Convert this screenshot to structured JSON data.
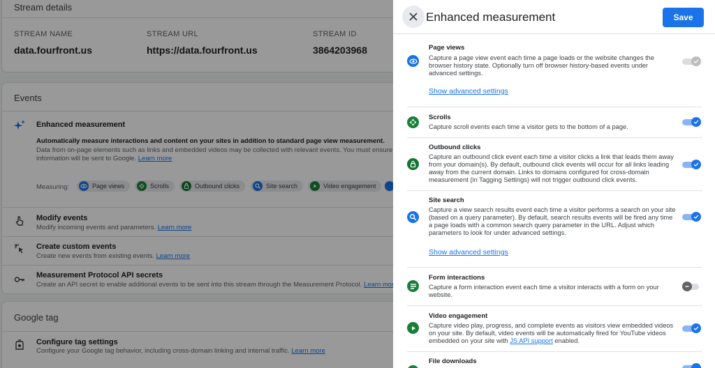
{
  "stream_details": {
    "title": "Stream details",
    "name_label": "STREAM NAME",
    "name_value": "data.fourfront.us",
    "url_label": "STREAM URL",
    "url_value": "https://data.fourfront.us",
    "id_label": "STREAM ID",
    "id_value": "3864203968"
  },
  "events": {
    "title": "Events",
    "enhanced": {
      "title": "Enhanced measurement",
      "desc_bold": "Automatically measure interactions and content on your sites in addition to standard page view measurement.",
      "desc_line1": "Data from on-page elements such as links and embedded videos may be collected with relevant events. You must ensure that",
      "desc_line2": "information will be sent to Google.",
      "learn_more": "Learn more",
      "measuring_label": "Measuring:",
      "chips": [
        {
          "label": "Page views",
          "icon": "eye-icon",
          "color": "#1a73e8"
        },
        {
          "label": "Scrolls",
          "icon": "scroll-icon",
          "color": "#188038"
        },
        {
          "label": "Outbound clicks",
          "icon": "lock-icon",
          "color": "#137333"
        },
        {
          "label": "Site search",
          "icon": "search-icon",
          "color": "#1a73e8"
        },
        {
          "label": "Video engagement",
          "icon": "play-icon",
          "color": "#188038"
        }
      ]
    },
    "modify": {
      "title": "Modify events",
      "desc": "Modify incoming events and parameters.",
      "learn_more": "Learn more"
    },
    "custom": {
      "title": "Create custom events",
      "desc": "Create new events from existing events.",
      "learn_more": "Learn more"
    },
    "mp": {
      "title": "Measurement Protocol API secrets",
      "desc": "Create an API secret to enable additional events to be sent into this stream through the Measurement Protocol.",
      "learn_more": "Learn more"
    }
  },
  "google_tag": {
    "title": "Google tag",
    "configure": {
      "title": "Configure tag settings",
      "desc": "Configure your Google tag behavior, including cross-domain linking and internal traffic.",
      "learn_more": "Learn more"
    }
  },
  "panel": {
    "title": "Enhanced measurement",
    "save_label": "Save",
    "events": [
      {
        "title": "Page views",
        "desc": "Capture a page view event each time a page loads or the website changes the browser history state. Optionally turn off browser history-based events under advanced settings.",
        "link": "Show advanced settings",
        "toggle": "on-disabled",
        "icon": "eye-icon",
        "color": "#1a73e8"
      },
      {
        "title": "Scrolls",
        "desc": "Capture scroll events each time a visitor gets to the bottom of a page.",
        "toggle": "on",
        "icon": "scroll-icon",
        "color": "#188038"
      },
      {
        "title": "Outbound clicks",
        "desc": "Capture an outbound click event each time a visitor clicks a link that leads them away from your domain(s). By default, outbound click events will occur for all links leading away from the current domain. Links to domains configured for cross-domain measurement (in Tagging Settings) will not trigger outbound click events.",
        "toggle": "on",
        "icon": "lock-icon",
        "color": "#137333"
      },
      {
        "title": "Site search",
        "desc": "Capture a view search results event each time a visitor performs a search on your site (based on a query parameter). By default, search results events will be fired any time a page loads with a common search query parameter in the URL. Adjust which parameters to look for under advanced settings.",
        "link": "Show advanced settings",
        "toggle": "on",
        "icon": "search-icon",
        "color": "#1a73e8"
      },
      {
        "title": "Form interactions",
        "desc": "Capture a form interaction event each time a visitor interacts with a form on your website.",
        "toggle": "off",
        "icon": "form-icon",
        "color": "#188038"
      },
      {
        "title": "Video engagement",
        "desc_before": "Capture video play, progress, and complete events as visitors view embedded videos on your site. By default, video events will be automatically fired for YouTube videos embedded on your site with ",
        "desc_link": "JS API support",
        "desc_after": " enabled.",
        "toggle": "on",
        "icon": "play-icon",
        "color": "#188038"
      },
      {
        "title": "File downloads",
        "toggle": "on",
        "icon": "download-icon",
        "color": "#188038"
      }
    ]
  }
}
